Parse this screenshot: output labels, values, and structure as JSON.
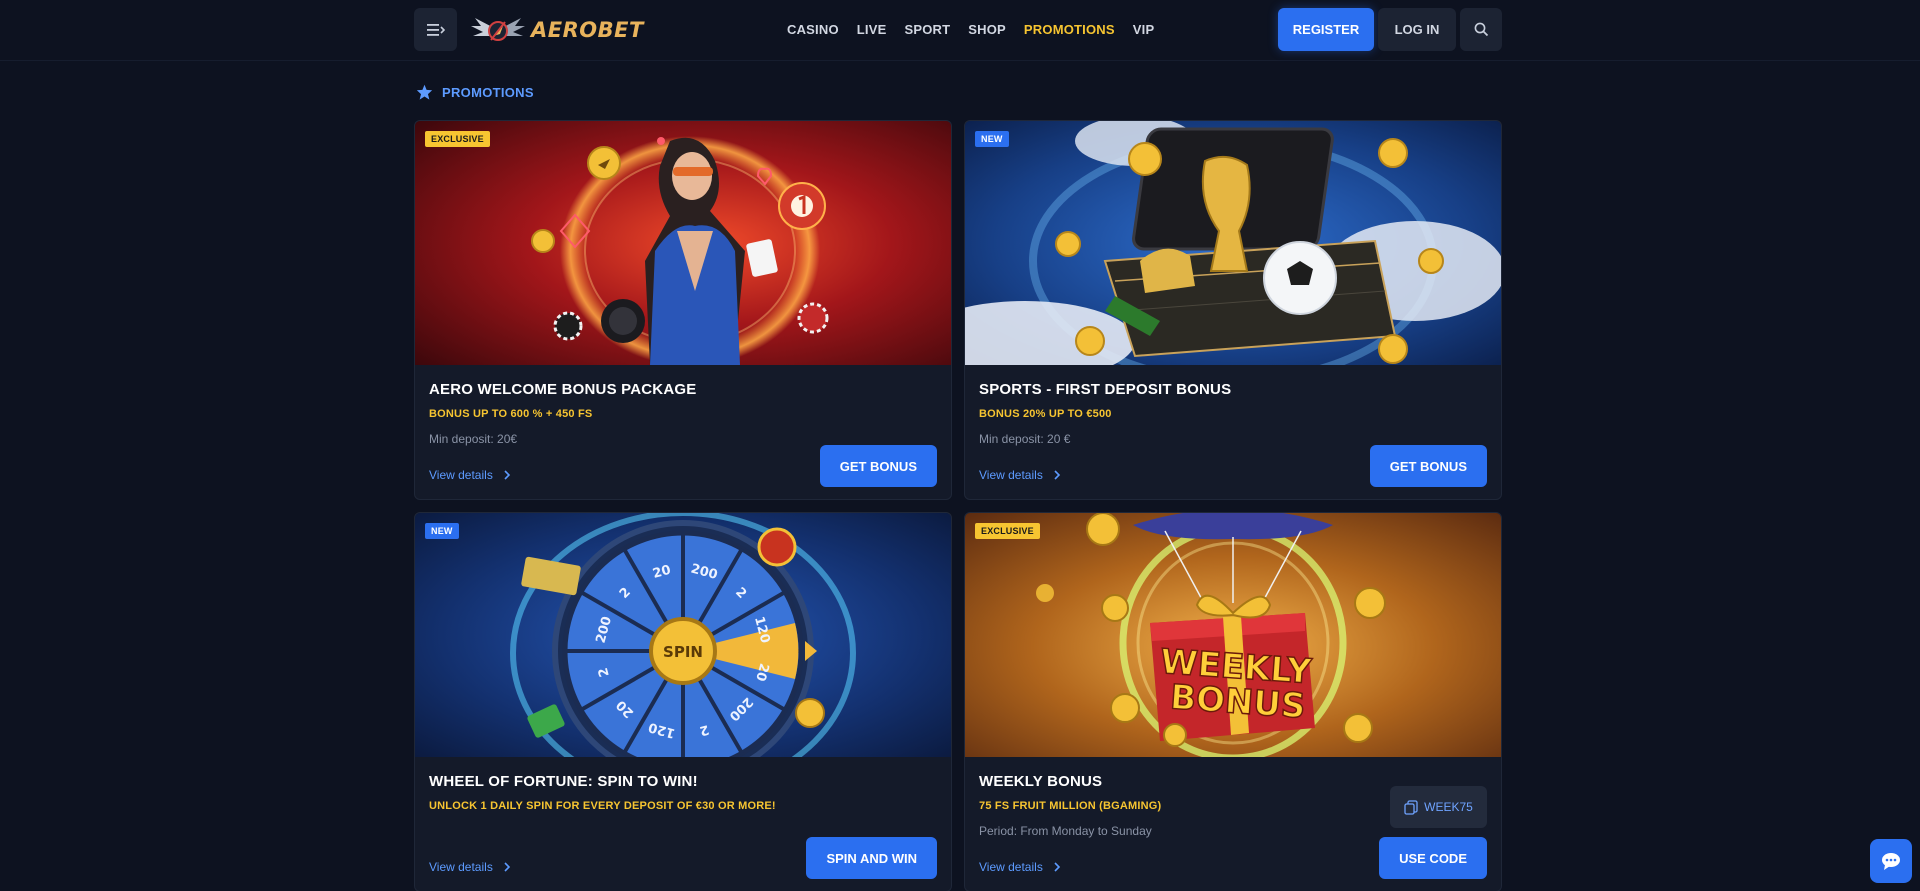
{
  "header": {
    "logo_text": "AEROBET",
    "nav": [
      "CASINO",
      "LIVE",
      "SPORT",
      "SHOP",
      "PROMOTIONS",
      "VIP"
    ],
    "active_nav": "PROMOTIONS",
    "register_label": "REGISTER",
    "login_label": "LOG IN"
  },
  "section": {
    "title": "PROMOTIONS"
  },
  "cards": [
    {
      "badge": "EXCLUSIVE",
      "title": "AERO WELCOME BONUS PACKAGE",
      "subtitle": "BONUS UP TO 600 % + 450 FS",
      "meta": "Min deposit: 20€",
      "details": "View details",
      "cta": "GET BONUS"
    },
    {
      "badge": "NEW",
      "title": "SPORTS - FIRST DEPOSIT BONUS",
      "subtitle": "BONUS 20% UP TO €500",
      "meta": "Min deposit: 20 €",
      "details": "View details",
      "cta": "GET BONUS"
    },
    {
      "badge": "NEW",
      "title": "WHEEL OF FORTUNE: SPIN TO WIN!",
      "subtitle": "UNLOCK 1 DAILY SPIN FOR EVERY DEPOSIT OF €30 OR MORE!",
      "meta": "",
      "details": "View details",
      "cta": "SPIN AND WIN",
      "wheel_center": "SPIN",
      "wheel_values": [
        "200",
        "2",
        "120",
        "20",
        "200",
        "2",
        "120",
        "20",
        "2",
        "200",
        "2",
        "20"
      ]
    },
    {
      "badge": "EXCLUSIVE",
      "title": "WEEKLY BONUS",
      "subtitle": "75 FS FRUIT MILLION (BGAMING)",
      "meta": "Period: From Monday to Sunday",
      "details": "View details",
      "cta": "USE CODE",
      "code": "WEEK75",
      "art_text_1": "WEEKLY",
      "art_text_2": "BONUS"
    }
  ],
  "colors": {
    "background": "#0d1220",
    "accent_blue": "#2b6ff0",
    "accent_yellow": "#f7c531",
    "card_bg": "#141a29"
  }
}
